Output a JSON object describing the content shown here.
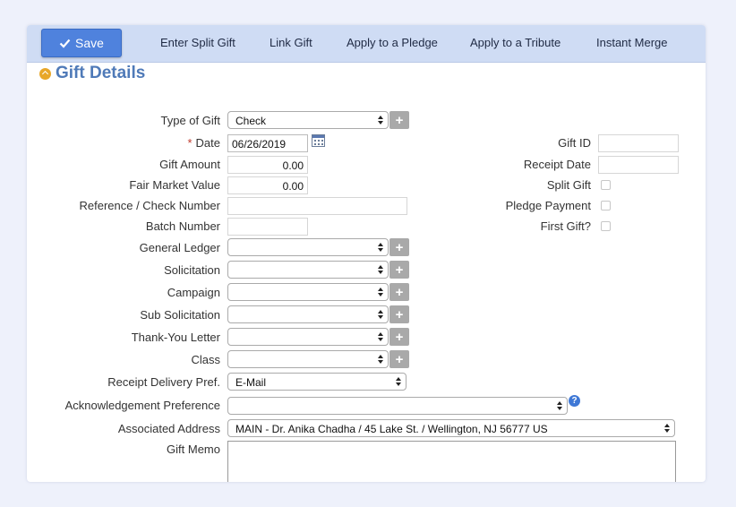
{
  "toolbar": {
    "save_label": "Save",
    "links": [
      "Enter Split Gift",
      "Link Gift",
      "Apply to a Pledge",
      "Apply to a Tribute",
      "Instant Merge"
    ]
  },
  "section": {
    "title": "Gift Details"
  },
  "form": {
    "type_of_gift": {
      "label": "Type of Gift",
      "value": "Check"
    },
    "date": {
      "required_mark": "*",
      "label": "Date",
      "value": "06/26/2019"
    },
    "gift_amount": {
      "label": "Gift Amount",
      "value": "0.00"
    },
    "fair_market_value": {
      "label": "Fair Market Value",
      "value": "0.00"
    },
    "reference_check_number": {
      "label": "Reference / Check Number",
      "value": ""
    },
    "batch_number": {
      "label": "Batch Number",
      "value": ""
    },
    "general_ledger": {
      "label": "General Ledger",
      "value": ""
    },
    "solicitation": {
      "label": "Solicitation",
      "value": ""
    },
    "campaign": {
      "label": "Campaign",
      "value": ""
    },
    "sub_solicitation": {
      "label": "Sub Solicitation",
      "value": ""
    },
    "thank_you_letter": {
      "label": "Thank-You Letter",
      "value": ""
    },
    "class": {
      "label": "Class",
      "value": ""
    },
    "receipt_delivery_pref": {
      "label": "Receipt Delivery Pref.",
      "value": "E-Mail"
    },
    "acknowledgement_preference": {
      "label": "Acknowledgement Preference",
      "value": ""
    },
    "associated_address": {
      "label": "Associated Address",
      "value": "MAIN - Dr. Anika Chadha / 45 Lake St. / Wellington, NJ 56777 US"
    },
    "gift_memo": {
      "label": "Gift Memo",
      "value": ""
    },
    "gift_id": {
      "label": "Gift ID",
      "value": ""
    },
    "receipt_date": {
      "label": "Receipt Date",
      "value": ""
    },
    "split_gift": {
      "label": "Split Gift",
      "checked": false
    },
    "pledge_payment": {
      "label": "Pledge Payment",
      "checked": false
    },
    "first_gift": {
      "label": "First Gift?",
      "checked": false
    }
  },
  "icons": {
    "add": "+",
    "help": "?"
  },
  "colors": {
    "save_button": "#4f82dd",
    "toolbar": "#cfdcf4",
    "section_title": "#4f7ab8",
    "section_icon": "#e8a72a",
    "required": "#c0392b"
  }
}
